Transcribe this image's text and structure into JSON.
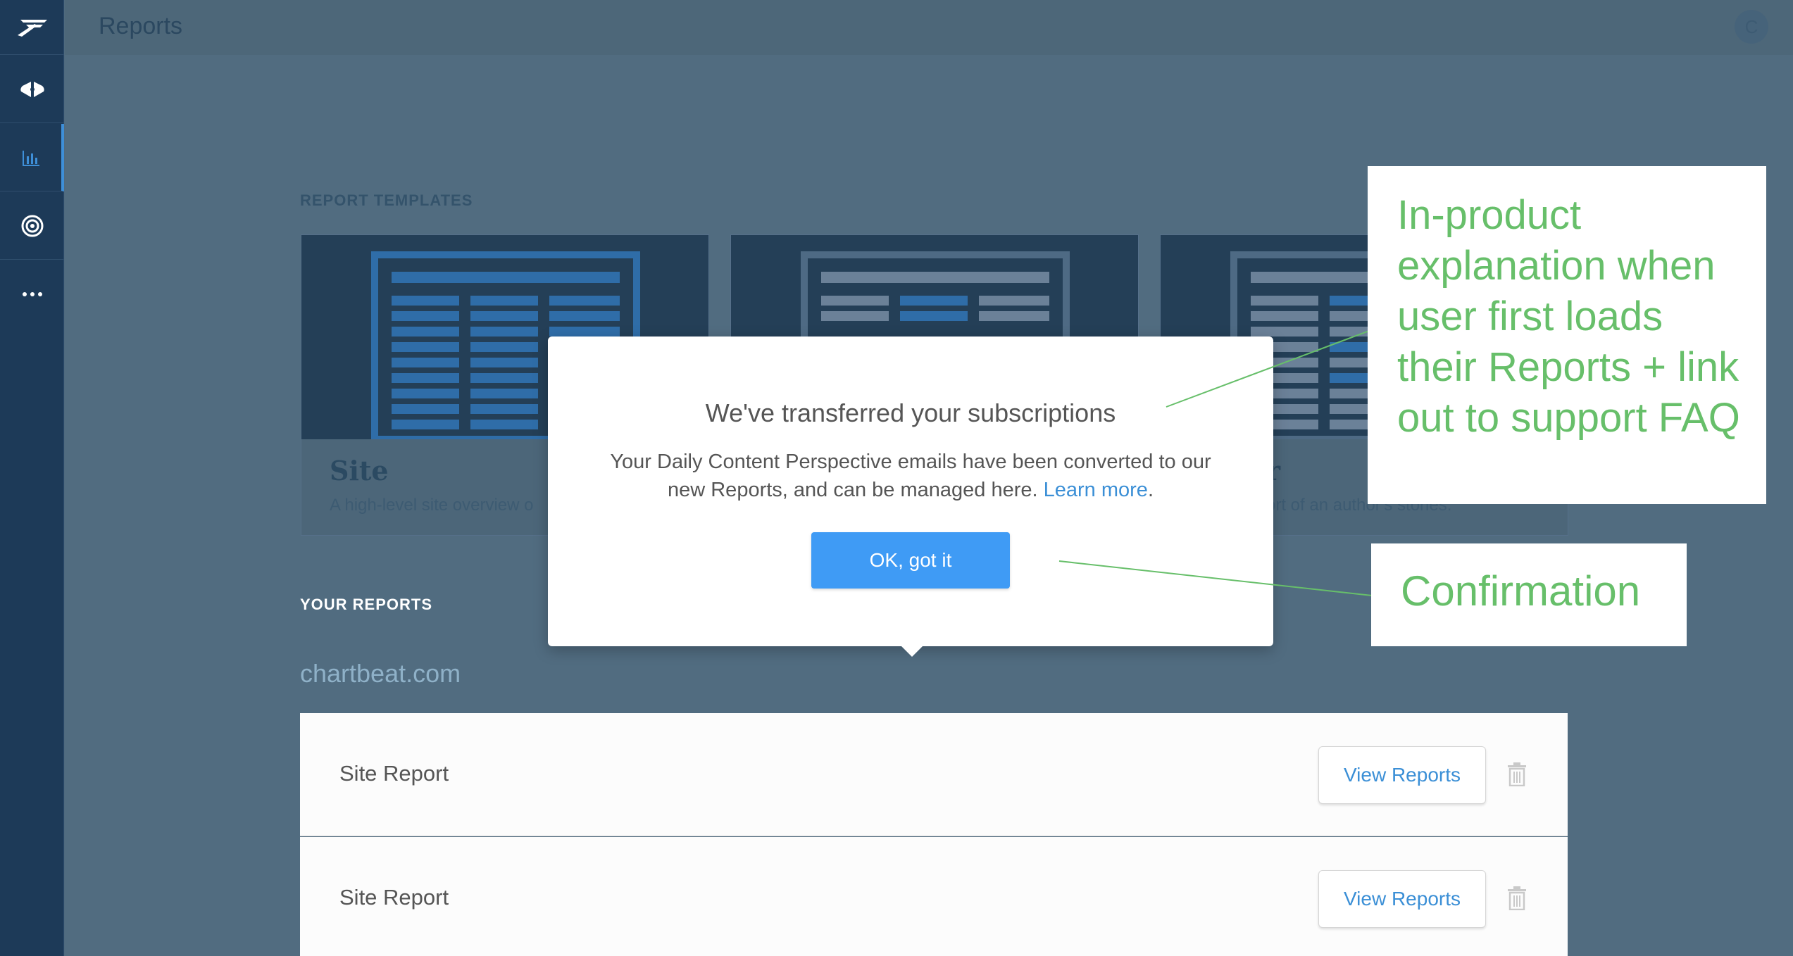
{
  "header": {
    "title": "Reports",
    "avatar_initial": "C"
  },
  "sidebar": {
    "items": [
      {
        "icon": "chartbeat-logo-icon"
      },
      {
        "icon": "dashboard-icon"
      },
      {
        "icon": "reports-bar-chart-icon",
        "active": true
      },
      {
        "icon": "target-icon"
      },
      {
        "icon": "more-dots-icon"
      }
    ]
  },
  "templates": {
    "section_label": "REPORT TEMPLATES",
    "cards": [
      {
        "name": "Site",
        "description": "A high-level site overview o"
      },
      {
        "name": "",
        "description": ""
      },
      {
        "name": "r",
        "description": "ort of an author's stories."
      }
    ]
  },
  "your_reports": {
    "section_label": "YOUR REPORTS",
    "domain": "chartbeat.com",
    "rows": [
      {
        "name": "Site Report",
        "button": "View Reports"
      },
      {
        "name": "Site Report",
        "button": "View Reports"
      }
    ]
  },
  "modal": {
    "title": "We've transferred your subscriptions",
    "body": "Your Daily Content Perspective emails have been converted to our new Reports, and can be managed here.",
    "link_text": "Learn more",
    "body_end": ".",
    "ok_label": "OK, got it"
  },
  "annotations": {
    "callout_1": "In-product explanation when user first loads their Reports + link out to support FAQ",
    "callout_2": "Confirmation",
    "color": "#67bf6a"
  }
}
